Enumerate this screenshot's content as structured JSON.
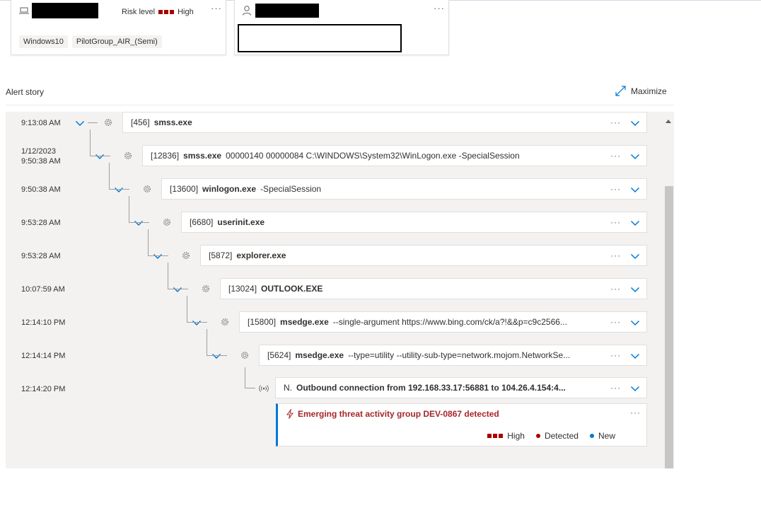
{
  "device_card": {
    "risk_label": "Risk level",
    "risk_value": "High",
    "tags": [
      "Windows10",
      "PilotGroup_AIR_(Semi)"
    ],
    "more": "···"
  },
  "user_card": {
    "more": "···"
  },
  "story": {
    "title": "Alert story",
    "maximize_label": "Maximize",
    "rows": [
      {
        "time": "9:13:08 AM",
        "date": "",
        "pid": "[456]",
        "name": "smss.exe",
        "args": ""
      },
      {
        "time": "9:50:38 AM",
        "date": "1/12/2023",
        "pid": "[12836]",
        "name": "smss.exe",
        "args": "00000140 00000084 C:\\WINDOWS\\System32\\WinLogon.exe -SpecialSession"
      },
      {
        "time": "9:50:38 AM",
        "date": "",
        "pid": "[13600]",
        "name": "winlogon.exe",
        "args": "-SpecialSession"
      },
      {
        "time": "9:53:28 AM",
        "date": "",
        "pid": "[6680]",
        "name": "userinit.exe",
        "args": ""
      },
      {
        "time": "9:53:28 AM",
        "date": "",
        "pid": "[5872]",
        "name": "explorer.exe",
        "args": ""
      },
      {
        "time": "10:07:59 AM",
        "date": "",
        "pid": "[13024]",
        "name": "OUTLOOK.EXE",
        "args": ""
      },
      {
        "time": "12:14:10 PM",
        "date": "",
        "pid": "[15800]",
        "name": "msedge.exe",
        "args": "--single-argument https://www.bing.com/ck/a?!&&p=c9c2566..."
      },
      {
        "time": "12:14:14 PM",
        "date": "",
        "pid": "[5624]",
        "name": "msedge.exe",
        "args": "--type=utility --utility-sub-type=network.mojom.NetworkSe..."
      }
    ],
    "connection": {
      "time": "12:14:20 PM",
      "prefix": "N.",
      "text": "Outbound connection from 192.168.33.17:56881 to 104.26.4.154:4..."
    },
    "alert": {
      "title": "Emerging threat activity group DEV-0867 detected",
      "severity": "High",
      "status": "Detected",
      "state": "New",
      "colors": {
        "severity": "#a80000",
        "status": "#a80000",
        "state": "#0078d4"
      }
    }
  }
}
